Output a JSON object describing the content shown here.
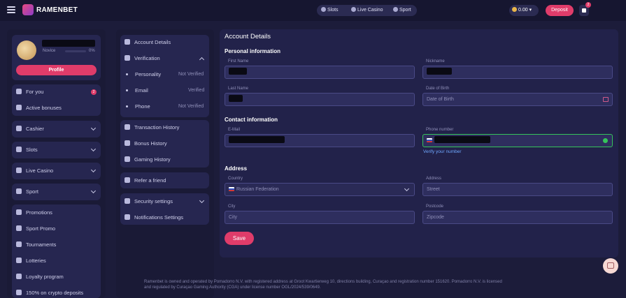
{
  "brand": {
    "name": "RAMENBET"
  },
  "topnav": {
    "slots": "Slots",
    "live_casino": "Live Casino",
    "sport": "Sport"
  },
  "header": {
    "balance": "0.00",
    "deposit": "Deposit",
    "gift_count": "2"
  },
  "user": {
    "level": "Novice",
    "progress_text": "0%",
    "progress": 0,
    "profile_button": "Profile"
  },
  "left_menu": {
    "for_you": "For you",
    "for_you_badge": "2",
    "active_bonuses": "Active bonuses",
    "cashier": "Cashier",
    "slots": "Slots",
    "live_casino": "Live Casino",
    "sport": "Sport",
    "promotions": "Promotions",
    "sport_promo": "Sport Promo",
    "tournaments": "Tournaments",
    "lotteries": "Lotteries",
    "loyalty": "Loyalty program",
    "crypto": "150% on crypto deposits"
  },
  "account_menu": {
    "account_details": "Account Details",
    "verification": "Verification",
    "personality": "Personality",
    "personality_status": "Not Verified",
    "email": "Email",
    "email_status": "Verified",
    "phone": "Phone",
    "phone_status": "Not Verified",
    "transaction_history": "Transaction History",
    "bonus_history": "Bonus History",
    "gaming_history": "Gaming History",
    "refer": "Refer a friend",
    "security": "Security settings",
    "notifications": "Notifications Settings"
  },
  "form": {
    "title": "Account Details",
    "personal_section": "Personal information",
    "first_name_label": "First Name",
    "nickname_label": "Nickname",
    "last_name_label": "Last Name",
    "dob_label": "Date of Birth",
    "dob_placeholder": "Date of Birth",
    "contact_section": "Contact information",
    "email_label": "E-Mail",
    "phone_label": "Phone number",
    "verify_phone": "Verify your number",
    "address_section": "Address",
    "country_label": "Country",
    "country_value": "Russian Federation",
    "address_label": "Address",
    "address_placeholder": "Street",
    "city_label": "City",
    "city_placeholder": "City",
    "postcode_label": "Postcode",
    "postcode_placeholder": "Zipcode",
    "save": "Save"
  },
  "footer": {
    "line1": "Ramenbet is owned and operated by Pomadorro N.V. with registered address at Groot Kwartierweg 10, directions building, Curaçao and registration number 151620. Pomadorro N.V. is licensed",
    "line2": "and regulated by Curaçao Gaming Authority (CGA) under license number OGL/2024/539/0649."
  },
  "colors": {
    "accent": "#e03c6a",
    "bg": "#1c1c3a",
    "panel": "#22224a",
    "verified": "#35c45a"
  }
}
